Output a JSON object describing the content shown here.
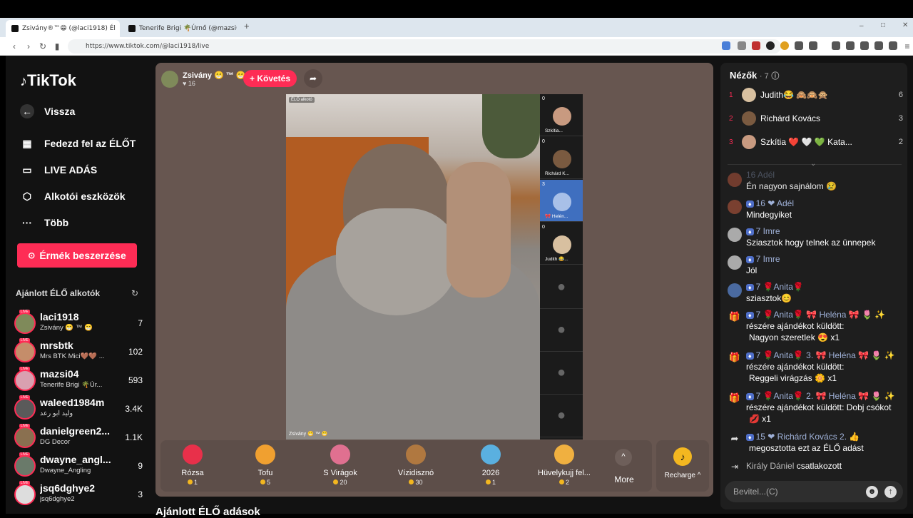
{
  "browser": {
    "tabs": [
      {
        "title": "Zsivány®™😁 (@laci1918) Él"
      },
      {
        "title": "Tenerife Brigi 🌴Úrnő (@mazsi04) É"
      }
    ],
    "url": "https://www.tiktok.com/@laci1918/live",
    "new_tab": "+",
    "controls": [
      "–",
      "□",
      "✕"
    ]
  },
  "sidebar": {
    "logo": "TikTok",
    "nav": [
      {
        "label": "Vissza",
        "icon": "back-arrow-icon"
      },
      {
        "label": "Fedezd fel az ÉLŐT",
        "icon": "calendar-icon"
      },
      {
        "label": "LIVE ADÁS",
        "icon": "camera-icon"
      },
      {
        "label": "Alkotói eszközök",
        "icon": "creator-tools-icon"
      },
      {
        "label": "Több",
        "icon": "more-icon"
      }
    ],
    "coin_button": "Érmék beszerzése",
    "recommended_title": "Ajánlott ÉLŐ alkotók",
    "live_tag": "LIVE",
    "creators": [
      {
        "name": "laci1918",
        "sub": "Zsivány 😁 ™ 😁",
        "count": "7",
        "color": "#7f8a5a"
      },
      {
        "name": "mrsbtk",
        "sub": "Mrs BTK Mici🤎🤎 ...",
        "count": "102",
        "color": "#c58d6a"
      },
      {
        "name": "mazsi04",
        "sub": "Tenerife Brigi 🌴Úr...",
        "count": "593",
        "color": "#d9a0b0"
      },
      {
        "name": "waleed1984m",
        "sub": "وليد ابو رعد",
        "count": "3.4K",
        "color": "#5a5a5a"
      },
      {
        "name": "danielgreen2...",
        "sub": "DG Decor",
        "count": "1.1K",
        "color": "#8a7050"
      },
      {
        "name": "dwayne_angl...",
        "sub": "Dwayne_Angling",
        "count": "9",
        "color": "#6a7a6a"
      },
      {
        "name": "jsq6dghye2",
        "sub": "jsq6dghye2",
        "count": "3",
        "color": "#dddddd"
      }
    ]
  },
  "stream": {
    "host_name": "Zsivány 😁 ™ 😁",
    "host_likes": "♥ 16",
    "follow": "+ Követés",
    "live_label": "ÉLŐ alkotó",
    "video_caption": "Zsivány 😁 ™ 😁",
    "guests": [
      {
        "name": "Szkítia...",
        "count": "0",
        "color": "#c89a80"
      },
      {
        "name": "Richárd K...",
        "count": "0",
        "color": "#7a5a40"
      },
      {
        "name": "🎀 Helén...",
        "count": "3",
        "color": "#a8c0e8"
      },
      {
        "name": "Judith 😂...",
        "count": "0",
        "color": "#d8c0a0"
      }
    ]
  },
  "gifts": [
    {
      "name": "Rózsa",
      "price": "1",
      "color": "#e8304a"
    },
    {
      "name": "Tofu",
      "price": "5",
      "color": "#f0a030"
    },
    {
      "name": "S Virágok",
      "price": "20",
      "color": "#e07090"
    },
    {
      "name": "Vízidisznó",
      "price": "30",
      "color": "#b07840"
    },
    {
      "name": "2026",
      "price": "1",
      "color": "#5ab0e0"
    },
    {
      "name": "Hüvelykujj fel...",
      "price": "2",
      "color": "#f0b040"
    }
  ],
  "gift_more": "More",
  "recharge": "Recharge ^",
  "viewers": {
    "title": "Nézők",
    "count": "· 7",
    "list": [
      {
        "rank": "1",
        "name": "Judith😂 🙈🙉🙊",
        "count": "6"
      },
      {
        "rank": "2",
        "name": "Richárd Kovács",
        "count": "3"
      },
      {
        "rank": "3",
        "name": "Szkítia ❤️ 🤍 💚 Kata...",
        "count": "2"
      }
    ]
  },
  "chat": [
    {
      "header": "16 Adél",
      "text": "Én nagyon sajnálom 😢",
      "avatar": "#7a4030"
    },
    {
      "header": "16 ❤ Adél",
      "text": "Mindegyiket",
      "avatar": "#7a4030"
    },
    {
      "header": "7 Imre",
      "text": "Sziasztok hogy telnek az ünnepek",
      "avatar": "#aaaaaa"
    },
    {
      "header": "7 Imre",
      "text": "Jól",
      "avatar": "#aaaaaa"
    },
    {
      "header": "7 🌹Anita🌹",
      "text": "sziasztok😊",
      "avatar": "#4a6aa0"
    },
    {
      "header": "7 🌹Anita🌹 🎀 Heléna 🎀 🌷 ✨",
      "text": "részére ajándékot küldött:",
      "text2": "Nagyon szeretlek 😍 x1",
      "avatar": "gift"
    },
    {
      "header": "7 🌹Anita🌹 3. 🎀 Heléna 🎀 🌷 ✨",
      "text": "részére ajándékot küldött:",
      "text2": "Reggeli virágzás 🌼 x1",
      "avatar": "gift"
    },
    {
      "header": "7 🌹Anita🌹 2. 🎀 Heléna 🎀 🌷 ✨",
      "text": "részére ajándékot küldött: Dobj csókot",
      "text2": "💋 x1",
      "avatar": "gift"
    },
    {
      "header": "15 ❤ Richárd Kovács 2. 👍",
      "text": "megosztotta ezt az ÉLŐ adást",
      "avatar": "share"
    },
    {
      "header": "Király Dániel",
      "text": "csatlakozott",
      "avatar": "join"
    }
  ],
  "chat_input_placeholder": "Bevitel...(C)",
  "bottom_section": "Ajánlott ÉLŐ adások"
}
